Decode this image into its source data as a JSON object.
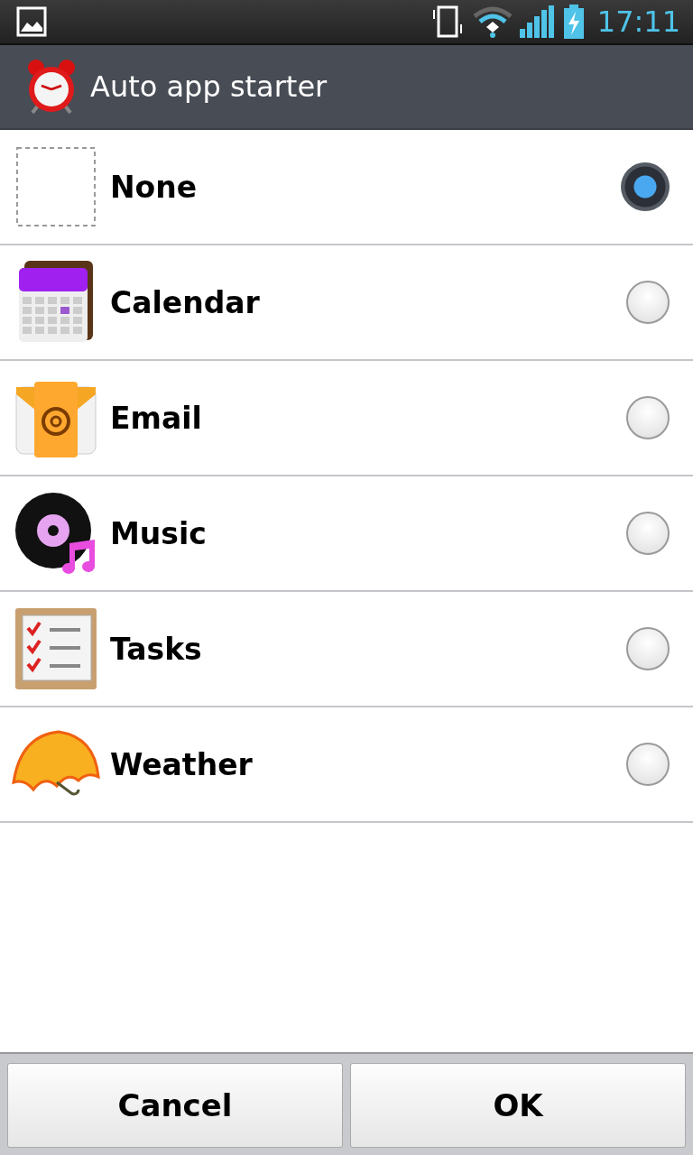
{
  "status_bar": {
    "time": "17:11"
  },
  "title_bar": {
    "title": "Auto app starter"
  },
  "options": [
    {
      "kind": "none",
      "label": "None",
      "selected": true
    },
    {
      "kind": "calendar",
      "label": "Calendar",
      "selected": false
    },
    {
      "kind": "email",
      "label": "Email",
      "selected": false
    },
    {
      "kind": "music",
      "label": "Music",
      "selected": false
    },
    {
      "kind": "tasks",
      "label": "Tasks",
      "selected": false
    },
    {
      "kind": "weather",
      "label": "Weather",
      "selected": false
    }
  ],
  "buttons": [
    "Cancel",
    "OK"
  ]
}
